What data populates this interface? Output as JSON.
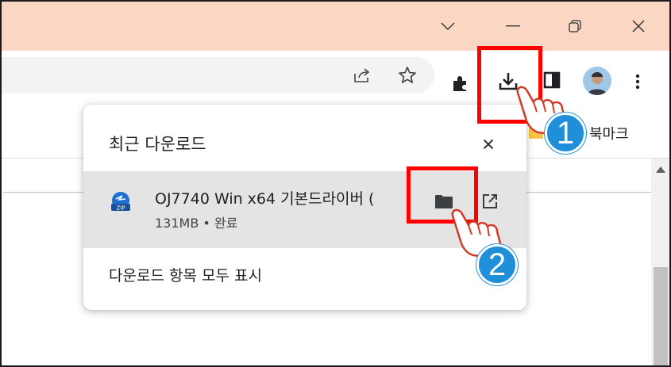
{
  "window": {
    "controls": [
      "chevron-down",
      "minimize",
      "restore",
      "close"
    ]
  },
  "toolbar": {
    "icons": [
      "share-icon",
      "star-icon",
      "extensions-icon",
      "download-icon",
      "sidepanel-icon",
      "avatar",
      "menu-icon"
    ]
  },
  "bookmarks_bar": {
    "label": "북마크"
  },
  "downloads_bubble": {
    "title": "최근 다운로드",
    "close_symbol": "✕",
    "item": {
      "filename": "OJ7740 Win x64 기본드라이버 (",
      "status": "131MB • 완료"
    },
    "show_all_label": "다운로드 항목 모두 표시"
  },
  "annotations": {
    "step1": "1",
    "step2": "2"
  },
  "colors": {
    "titlebar": "#fbd6c3",
    "highlight": "#ff0000",
    "badge": "#1e8fd8"
  }
}
